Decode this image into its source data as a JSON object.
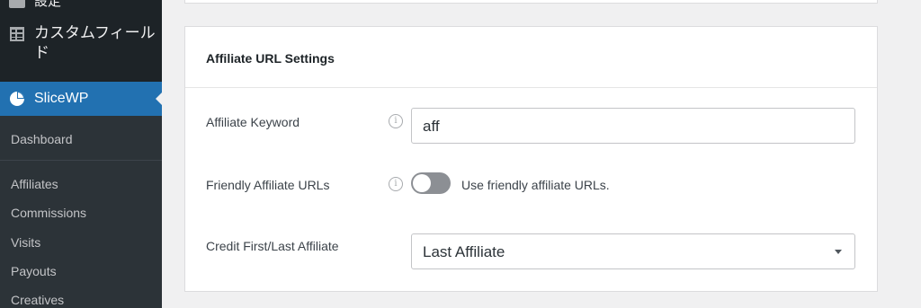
{
  "sidebar": {
    "settings_label": "設定",
    "custom_fields_label": "カスタムフィールド",
    "active_label": "SliceWP",
    "submenu": [
      "Dashboard",
      "Affiliates",
      "Commissions",
      "Visits",
      "Payouts",
      "Creatives"
    ]
  },
  "card": {
    "title": "Affiliate URL Settings",
    "keyword": {
      "label": "Affiliate Keyword",
      "value": "aff"
    },
    "friendly": {
      "label": "Friendly Affiliate URLs",
      "toggle_label": "Use friendly affiliate URLs.",
      "enabled": false
    },
    "credit": {
      "label": "Credit First/Last Affiliate",
      "value": "Last Affiliate"
    }
  },
  "colors": {
    "sidebar_bg": "#1d2327",
    "active_bg": "#2271b1",
    "page_bg": "#f0f0f1"
  }
}
